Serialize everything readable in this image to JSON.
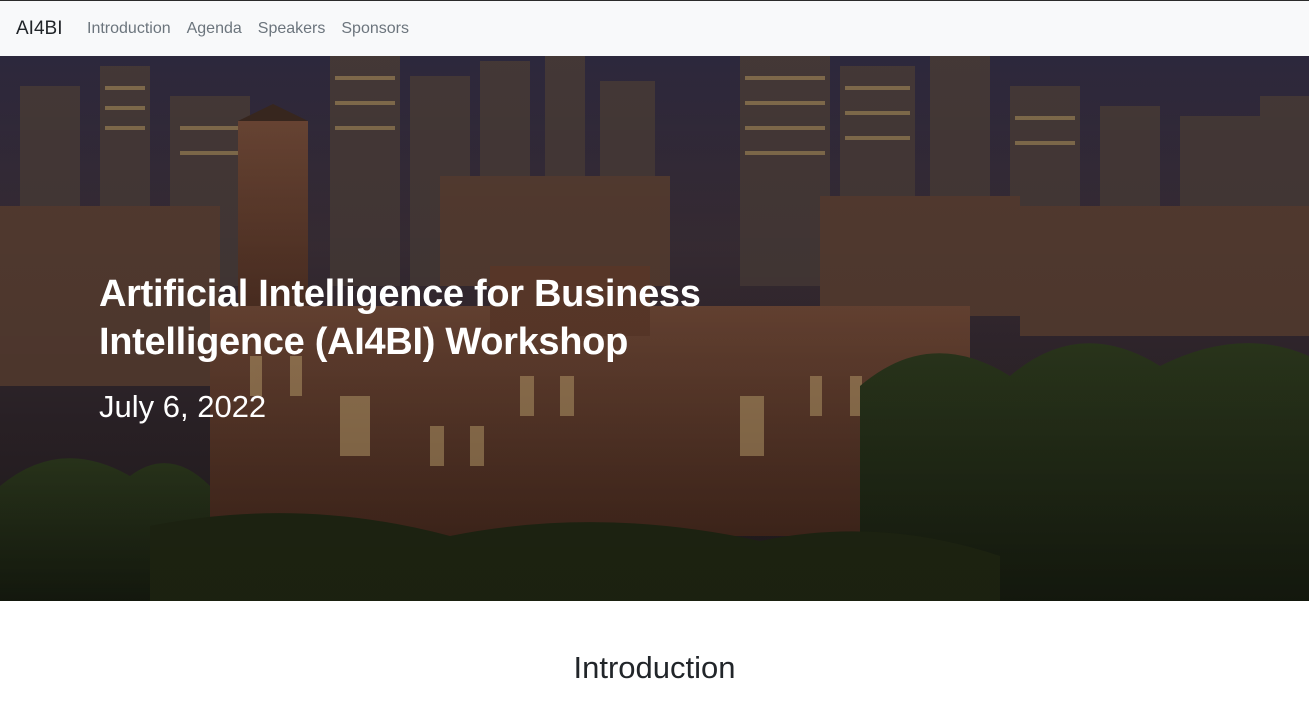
{
  "navbar": {
    "brand": "AI4BI",
    "links": [
      {
        "label": "Introduction"
      },
      {
        "label": "Agenda"
      },
      {
        "label": "Speakers"
      },
      {
        "label": "Sponsors"
      }
    ]
  },
  "hero": {
    "title": "Artificial Intelligence for Business Intelligence (AI4BI) Workshop",
    "date": "July 6, 2022",
    "background_image": "night city skyline with historic brick building and trees"
  },
  "sections": {
    "introduction_heading": "Introduction"
  },
  "colors": {
    "navbar_bg": "#f8f9fa",
    "brand_text": "#212529",
    "nav_link_text": "#6c757d",
    "hero_text": "#ffffff",
    "heading_text": "#212529"
  }
}
